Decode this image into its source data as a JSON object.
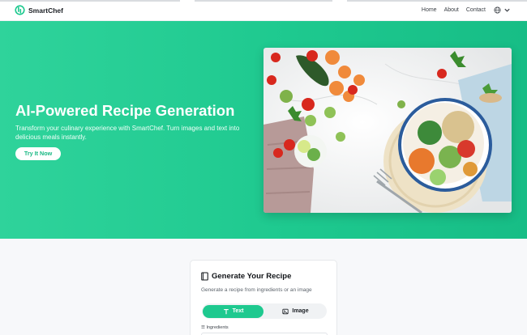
{
  "header": {
    "brand": "SmartChef",
    "nav": [
      "Home",
      "About",
      "Contact"
    ]
  },
  "hero": {
    "title": "AI-Powered Recipe Generation",
    "subtitle": "Transform your culinary experience with SmartChef. Turn images and text into delicious meals instantly.",
    "cta_label": "Try It Now",
    "image_alt": "Healthy vegetable bowl on marble table"
  },
  "generator": {
    "title": "Generate Your Recipe",
    "subtitle": "Generate a recipe from ingredients or an image",
    "tabs": [
      {
        "label": "Text",
        "icon": "text-icon",
        "active": true
      },
      {
        "label": "Image",
        "icon": "image-icon",
        "active": false
      }
    ],
    "ingredients_label": "Ingredients",
    "ingredients_value": ""
  },
  "colors": {
    "accent": "#1ec98f",
    "hero_start": "#2fd39b",
    "hero_end": "#17bd86",
    "text_dark": "#111418"
  }
}
